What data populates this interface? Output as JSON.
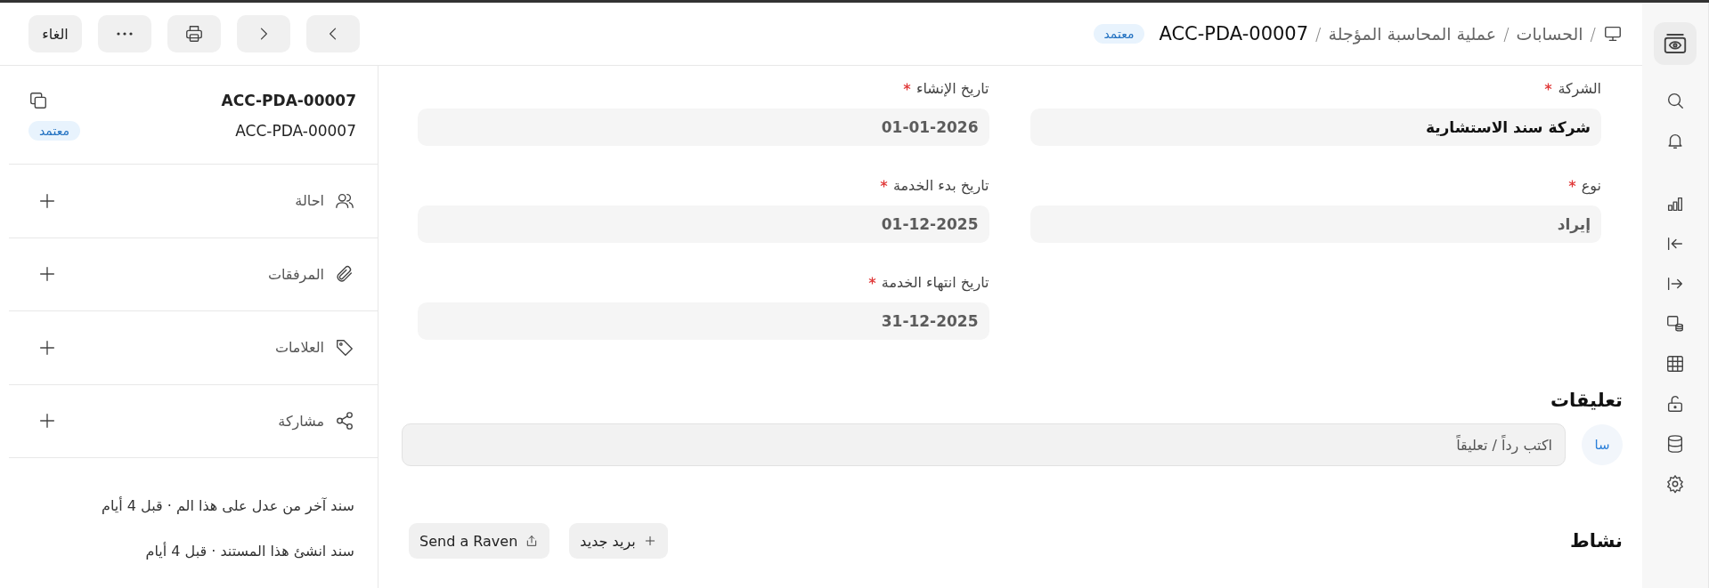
{
  "header": {
    "crumbs": [
      {
        "kind": "separator",
        "text": "/"
      },
      {
        "kind": "link",
        "text": "الحسابات"
      },
      {
        "kind": "separator",
        "text": "/"
      },
      {
        "kind": "link",
        "text": "عملية المحاسبة المؤجلة"
      },
      {
        "kind": "separator",
        "text": "/"
      }
    ],
    "title": "ACC-PDA-00007",
    "status": "معتمد",
    "buttons": [
      {
        "kind": "prev"
      },
      {
        "kind": "next"
      },
      {
        "kind": "print"
      },
      {
        "kind": "more"
      },
      {
        "kind": "text",
        "label": "الغاء"
      }
    ]
  },
  "rail": {
    "icons": [
      {
        "kind": "logo"
      },
      {
        "kind": "search"
      },
      {
        "kind": "bell"
      },
      {
        "kind": "chart"
      },
      {
        "kind": "collapse"
      },
      {
        "kind": "expand"
      },
      {
        "kind": "media"
      },
      {
        "kind": "table"
      },
      {
        "kind": "unlock"
      },
      {
        "kind": "database"
      },
      {
        "kind": "settings"
      }
    ]
  },
  "form": {
    "columns": [
      [
        {
          "label": "الشركة",
          "required": true,
          "kind": "link",
          "value": "شركة سند الاستشارية"
        },
        {
          "label": "نوع",
          "required": true,
          "kind": "select",
          "value": "إيراد"
        }
      ],
      [
        {
          "label": "تاريخ الإنشاء",
          "required": true,
          "kind": "date",
          "value": "01-01-2026"
        },
        {
          "label": "تاريخ بدء الخدمة",
          "required": true,
          "kind": "date",
          "value": "01-12-2025"
        },
        {
          "label": "تاريخ انتهاء الخدمة",
          "required": true,
          "kind": "date",
          "value": "31-12-2025"
        }
      ]
    ]
  },
  "comments": {
    "title": "تعليقات",
    "avatar": "سا",
    "placeholder": "اكتب رداً / تعليقاً"
  },
  "activity": {
    "title": "نشاط",
    "buttons": [
      {
        "kind": "email",
        "label": "بريد جديد"
      },
      {
        "kind": "raven",
        "label": "Send a Raven"
      }
    ]
  },
  "sidebar": {
    "title": "ACC-PDA-00007",
    "name": "ACC-PDA-00007",
    "status": "معتمد",
    "sections": [
      {
        "kind": "assign",
        "label": "احالة"
      },
      {
        "kind": "attachments",
        "label": "المرفقات"
      },
      {
        "kind": "tags",
        "label": "العلامات"
      },
      {
        "kind": "share",
        "label": "مشاركة"
      }
    ],
    "log": [
      "سند آخر من عدل على هذا الم · قبل 4 أيام",
      "سند انشئ هذا المستند · قبل 4 أيام"
    ]
  }
}
